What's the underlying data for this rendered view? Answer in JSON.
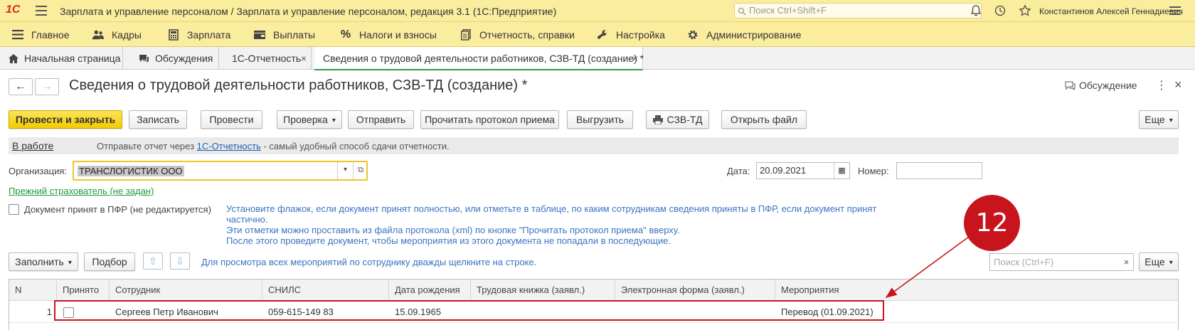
{
  "app": {
    "logo": "1С",
    "title": "Зарплата и управление персоналом / Зарплата и управление персоналом, редакция 3.1  (1С:Предприятие)",
    "search_placeholder": "Поиск Ctrl+Shift+F",
    "user": "Константинов Алексей Геннадиевич"
  },
  "sections": [
    {
      "label": "Главное",
      "icon": "menu-lines-icon"
    },
    {
      "label": "Кадры",
      "icon": "people-icon"
    },
    {
      "label": "Зарплата",
      "icon": "calculator-icon"
    },
    {
      "label": "Выплаты",
      "icon": "wallet-icon"
    },
    {
      "label": "Налоги и взносы",
      "icon": "percent-icon"
    },
    {
      "label": "Отчетность, справки",
      "icon": "report-icon"
    },
    {
      "label": "Настройка",
      "icon": "wrench-icon"
    },
    {
      "label": "Администрирование",
      "icon": "gear-icon"
    }
  ],
  "tabs": [
    {
      "label": "Начальная страница"
    },
    {
      "label": "Обсуждения"
    },
    {
      "label": "1С-Отчетность",
      "close": "×"
    },
    {
      "label": "Сведения о трудовой деятельности работников, СЗВ-ТД (создание) *",
      "close": "×"
    }
  ],
  "form": {
    "back": "←",
    "forward": "→",
    "title": "Сведения о трудовой деятельности работников, СЗВ-ТД (создание) *",
    "discussion": "Обсуждение",
    "more_dots": "⋮",
    "close": "×"
  },
  "toolbar": {
    "post_close": "Провести и закрыть",
    "save": "Записать",
    "post": "Провести",
    "check": "Проверка",
    "send": "Отправить",
    "read_protocol": "Прочитать протокол приема",
    "upload": "Выгрузить",
    "print_szv": "СЗВ-ТД",
    "open_file": "Открыть файл",
    "more": "Еще"
  },
  "infobar": {
    "status": "В работе",
    "text_before": "Отправьте отчет через ",
    "link": "1С-Отчетность",
    "text_after": " - самый удобный способ сдачи отчетности."
  },
  "fields": {
    "org_label": "Организация:",
    "org_value": "ТРАНСЛОГИСТИК ООО",
    "date_label": "Дата:",
    "date_value": "20.09.2021",
    "number_label": "Номер:",
    "number_value": "",
    "prev_insurer": "Прежний страхователь (не задан)",
    "pfr_checkbox": "Документ принят в ПФР (не редактируется)"
  },
  "note": {
    "line1": "Установите флажок, если документ принят полностью, или отметьте в таблице, по каким сотрудникам сведения приняты в ПФР, если документ принят частично.",
    "line2": "Эти отметки можно проставить из файла протокола (xml) по кнопке \"Прочитать протокол приема\" вверху.",
    "line3": "После этого проведите документ, чтобы мероприятия из этого документа не попадали в последующие."
  },
  "table_toolbar": {
    "fill": "Заполнить",
    "select": "Подбор",
    "up": "⇧",
    "down": "⇩",
    "hint": "Для просмотра всех мероприятий по сотруднику дважды щелкните на строке.",
    "search_placeholder": "Поиск (Ctrl+F)",
    "search_clear": "×",
    "more": "Еще"
  },
  "table": {
    "columns": [
      "N",
      "Принято",
      "Сотрудник",
      "СНИЛС",
      "Дата рождения",
      "Трудовая книжка (заявл.)",
      "Электронная форма (заявл.)",
      "Мероприятия"
    ],
    "rows": [
      {
        "n": "1",
        "accepted": false,
        "employee": "Сергеев Петр Иванович",
        "snils": "059-615-149 83",
        "birth": "15.09.1965",
        "paper": "",
        "electronic": "",
        "events": "Перевод (01.09.2021)"
      }
    ]
  },
  "annotation": {
    "number": "12",
    "color": "#c8141c"
  }
}
